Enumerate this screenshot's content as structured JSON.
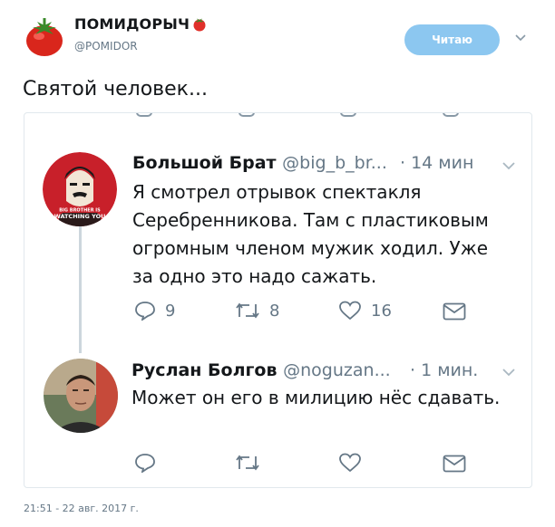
{
  "author": {
    "name": "ПОМИДОРЫЧ",
    "handle": "@POMIDOR",
    "follow_label": "Читаю"
  },
  "tweet": {
    "text": "Святой человек...",
    "timestamp": "21:51 - 22 авг. 2017 г."
  },
  "reply1": {
    "name": "Большой Брат",
    "handle": "@big_b_br...",
    "time": "· 14 мин",
    "lines": [
      "Я смотрел отрывок спектакля",
      "Серебренникова. Там с пластиковым",
      "огромным членом мужик ходил. Уже",
      "за одно это надо сажать."
    ],
    "replies": "9",
    "retweets": "8",
    "likes": "16",
    "avatar_caption_top": "BIG BROTHER IS",
    "avatar_caption_bottom": "WATCHING YOU"
  },
  "reply2": {
    "name": "Руслан Болгов",
    "handle": "@noguzan...",
    "time": "· 1 мин.",
    "lines": [
      "Может он его в милицию нёс сдавать."
    ]
  },
  "colors": {
    "follow_bg": "#8cc7f0",
    "text": "#14171a",
    "muted": "#657786",
    "tomato": "#e0302a"
  }
}
